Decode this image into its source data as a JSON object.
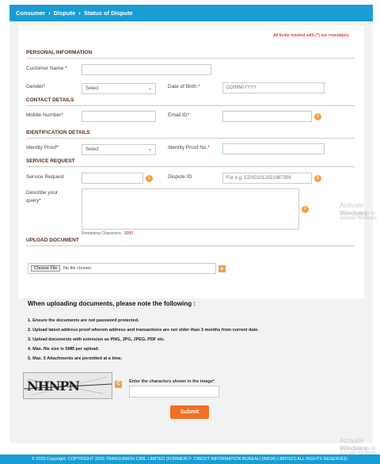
{
  "breadcrumb": [
    "Consumer",
    "Dispute",
    "Status of Dispute"
  ],
  "mandatory_note": "All fields marked with (*) are mandatory",
  "sections": {
    "personal": "PERSONAL INFORMATION",
    "contact": "CONTACT DETAILS",
    "identification": "IDENTIFICATION DETAILS",
    "service": "SERVICE REQUEST",
    "upload": "UPLOAD DOCUMENT"
  },
  "labels": {
    "customer_name": "Customer Name",
    "gender": "Gender",
    "dob": "Date of Birth",
    "mobile": "Mobile Number",
    "email": "Email ID",
    "identity_proof": "Identity Proof",
    "identity_proof_no": "Identity Proof No.",
    "service_request": "Service Request",
    "dispute_id": "Dispute ID",
    "describe": "Describe your query",
    "remaining": "Remaining Characters :",
    "remaining_count": "3000"
  },
  "required_mark": "*",
  "fields": {
    "gender_select": "Select",
    "dob_placeholder": "DD/MM/YYYY",
    "identity_select": "Select",
    "dispute_id_placeholder": "For e.g. CDS01012021987356"
  },
  "file": {
    "button": "Choose File",
    "status": "No file chosen",
    "add": "+"
  },
  "notes": {
    "heading": "When uploading documents, please note the following :",
    "items": [
      "1. Ensure the documents are not password protected.",
      "2. Upload latest address proof wherein address and transactions are not older than 3 months from current date.",
      "3. Upload documents with extension as PNG, JPG, JPEG, PDF etc.",
      "4. Max. file size is 5MB per upload.",
      "5. Max. 5 Attachments are permitted at a time."
    ]
  },
  "captcha": {
    "text": "NHNPN",
    "label": "Enter the characters shown in the image",
    "refresh": "C"
  },
  "submit": "Submit",
  "footer": "© 2020 Copyright: COPYRIGHT 2016 TRANSUNION CIBIL LIMITED (FORMERLY: CREDIT INFORMATION BUREAU (INDIA) LIMITED) ALL RIGHTS RESERVED.",
  "watermark": {
    "title": "Activate Windows",
    "sub": "Go to Settings to activate Windows."
  },
  "colors": {
    "accent": "#1a9cd4",
    "submit": "#f36f21",
    "info": "#f0a050",
    "footer": "#1a9cd4"
  }
}
